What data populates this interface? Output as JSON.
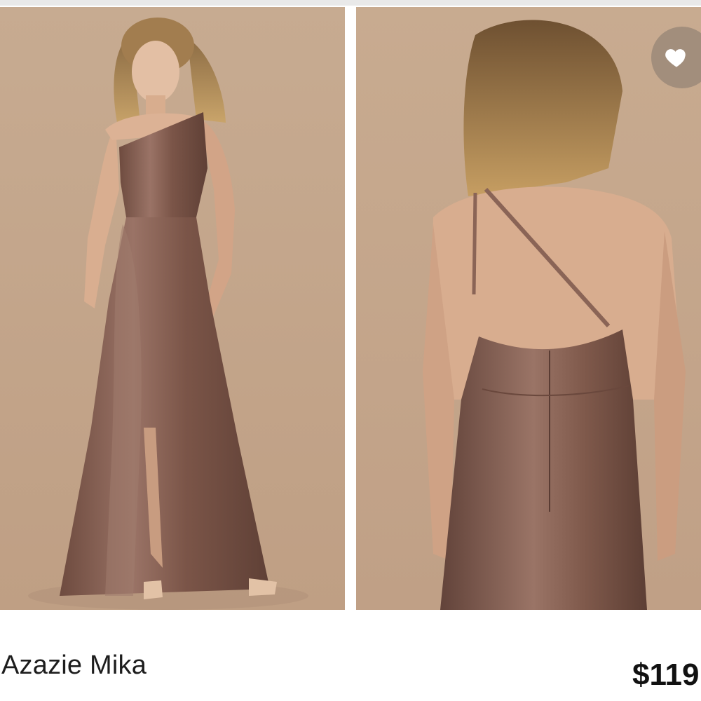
{
  "product": {
    "name": "Azazie Mika",
    "price": "$119"
  },
  "images": [
    {
      "view": "front"
    },
    {
      "view": "back"
    }
  ],
  "actions": {
    "favorite_icon": "heart-icon"
  },
  "colors": {
    "backdrop": "#c6a98e",
    "dress": "#7a5548",
    "favorite_button": "#968476"
  }
}
